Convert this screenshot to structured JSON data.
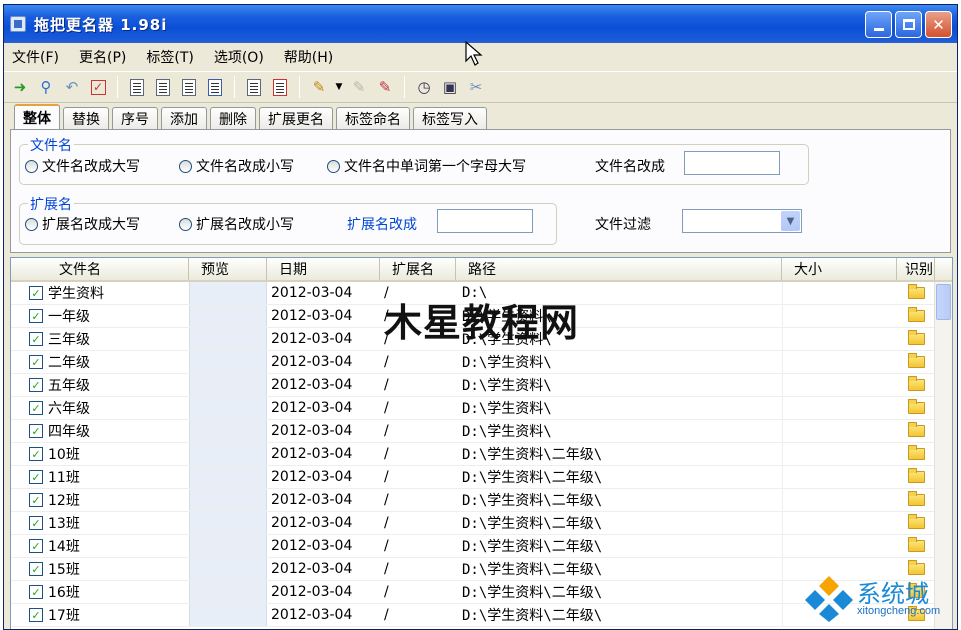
{
  "window": {
    "title": "拖把更名器 1.98i",
    "minimize_icon": "minimize-icon",
    "maximize_icon": "maximize-icon",
    "close_icon": "close-icon"
  },
  "menu": [
    "文件(F)",
    "更名(P)",
    "标签(T)",
    "选项(O)",
    "帮助(H)"
  ],
  "toolbar_icons": [
    "add-files-icon",
    "search-icon",
    "undo-icon",
    "check-icon",
    "page-1-icon",
    "page-2-icon",
    "page-3-icon",
    "page-4-icon",
    "document-icon",
    "close-doc-icon",
    "pen-icon",
    "pen-disabled-icon",
    "pen-delete-icon",
    "clock-icon",
    "window-icon",
    "tools-icon"
  ],
  "tabs": [
    "整体",
    "替换",
    "序号",
    "添加",
    "删除",
    "扩展更名",
    "标签命名",
    "标签写入"
  ],
  "panel": {
    "filename_group": "文件名",
    "filename_options": [
      "文件名改成大写",
      "文件名改成小写",
      "文件名中单词第一个字母大写"
    ],
    "filename_change_label": "文件名改成",
    "filename_change_value": "",
    "ext_group": "扩展名",
    "ext_options": [
      "扩展名改成大写",
      "扩展名改成小写"
    ],
    "ext_change_label": "扩展名改成",
    "ext_change_value": "",
    "filter_label": "文件过滤",
    "filter_value": ""
  },
  "table": {
    "columns": [
      "文件名",
      "预览",
      "日期",
      "扩展名",
      "路径",
      "大小",
      "识别"
    ],
    "rows": [
      {
        "name": "学生资料",
        "date": "2012-03-04",
        "ext": "/",
        "path": "D:\\",
        "checked": true
      },
      {
        "name": "一年级",
        "date": "2012-03-04",
        "ext": "/",
        "path": "D:\\学生资料\\",
        "checked": true
      },
      {
        "name": "三年级",
        "date": "2012-03-04",
        "ext": "/",
        "path": "D:\\学生资料\\",
        "checked": true
      },
      {
        "name": "二年级",
        "date": "2012-03-04",
        "ext": "/",
        "path": "D:\\学生资料\\",
        "checked": true
      },
      {
        "name": "五年级",
        "date": "2012-03-04",
        "ext": "/",
        "path": "D:\\学生资料\\",
        "checked": true
      },
      {
        "name": "六年级",
        "date": "2012-03-04",
        "ext": "/",
        "path": "D:\\学生资料\\",
        "checked": true
      },
      {
        "name": "四年级",
        "date": "2012-03-04",
        "ext": "/",
        "path": "D:\\学生资料\\",
        "checked": true
      },
      {
        "name": "10班",
        "date": "2012-03-04",
        "ext": "/",
        "path": "D:\\学生资料\\二年级\\",
        "checked": true
      },
      {
        "name": "11班",
        "date": "2012-03-04",
        "ext": "/",
        "path": "D:\\学生资料\\二年级\\",
        "checked": true
      },
      {
        "name": "12班",
        "date": "2012-03-04",
        "ext": "/",
        "path": "D:\\学生资料\\二年级\\",
        "checked": true
      },
      {
        "name": "13班",
        "date": "2012-03-04",
        "ext": "/",
        "path": "D:\\学生资料\\二年级\\",
        "checked": true
      },
      {
        "name": "14班",
        "date": "2012-03-04",
        "ext": "/",
        "path": "D:\\学生资料\\二年级\\",
        "checked": true
      },
      {
        "name": "15班",
        "date": "2012-03-04",
        "ext": "/",
        "path": "D:\\学生资料\\二年级\\",
        "checked": true
      },
      {
        "name": "16班",
        "date": "2012-03-04",
        "ext": "/",
        "path": "D:\\学生资料\\二年级\\",
        "checked": true
      },
      {
        "name": "17班",
        "date": "2012-03-04",
        "ext": "/",
        "path": "D:\\学生资料\\二年级\\",
        "checked": true
      }
    ]
  },
  "watermarks": {
    "center": "木星教程网",
    "corner_brand": "系统城",
    "corner_url": "xitongcheng.com"
  }
}
